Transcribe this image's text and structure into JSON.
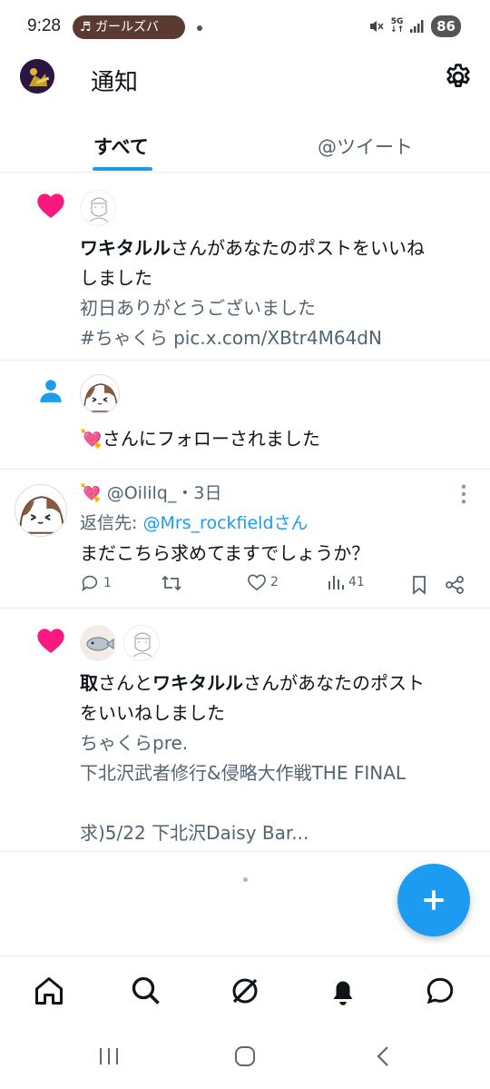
{
  "status_bar": {
    "time": "9:28",
    "media_pill": "♬ ガールズバ",
    "network_top": "5G",
    "network_bottom": "↓↑",
    "battery": "86"
  },
  "header": {
    "title": "通知",
    "settings_icon": "gear-icon"
  },
  "tabs": [
    {
      "label": "すべて",
      "active": true
    },
    {
      "label": "@ツイート",
      "active": false
    }
  ],
  "notifications": [
    {
      "type": "like",
      "icon": "heart-icon",
      "name": "ワキタルル",
      "action": "さんがあなたのポストをいいね",
      "action_wrap": "しました",
      "preview_line1": "初日ありがとうございました",
      "preview_line2": "#ちゃくら pic.x.com/XBtr4M64dN"
    },
    {
      "type": "follow",
      "icon": "person-icon",
      "emoji": "💘",
      "text": "さんにフォローされました"
    },
    {
      "type": "reply",
      "emoji": "💘",
      "handle": "@Oililq_",
      "time": "・3日",
      "reply_prefix": "返信先: ",
      "reply_to": "@Mrs_rockfieldさん",
      "body": "まだこちら求めてますでしょうか？",
      "stats": {
        "replies": "1",
        "retweets": "",
        "likes": "2",
        "views": "41"
      }
    },
    {
      "type": "like",
      "icon": "heart-icon",
      "name1": "取",
      "mid": "さんと",
      "name2": "ワキタルル",
      "action": "さんがあなたのポスト",
      "action_wrap": "をいいねしました",
      "preview_line1": "ちゃくらpre.",
      "preview_line2": "下北沢武者修行&侵略大作戦THE FINAL",
      "preview_line3": "求)5/22 下北沢Daisy Bar..."
    }
  ],
  "colors": {
    "accent": "#1d9bf0",
    "heart": "#f91880",
    "secondary_text": "#536471"
  },
  "bottom_nav": [
    "home-icon",
    "search-icon",
    "grok-icon",
    "bell-icon",
    "messages-icon"
  ],
  "system_nav": [
    "recent-apps-icon",
    "home-circle-icon",
    "back-icon"
  ]
}
